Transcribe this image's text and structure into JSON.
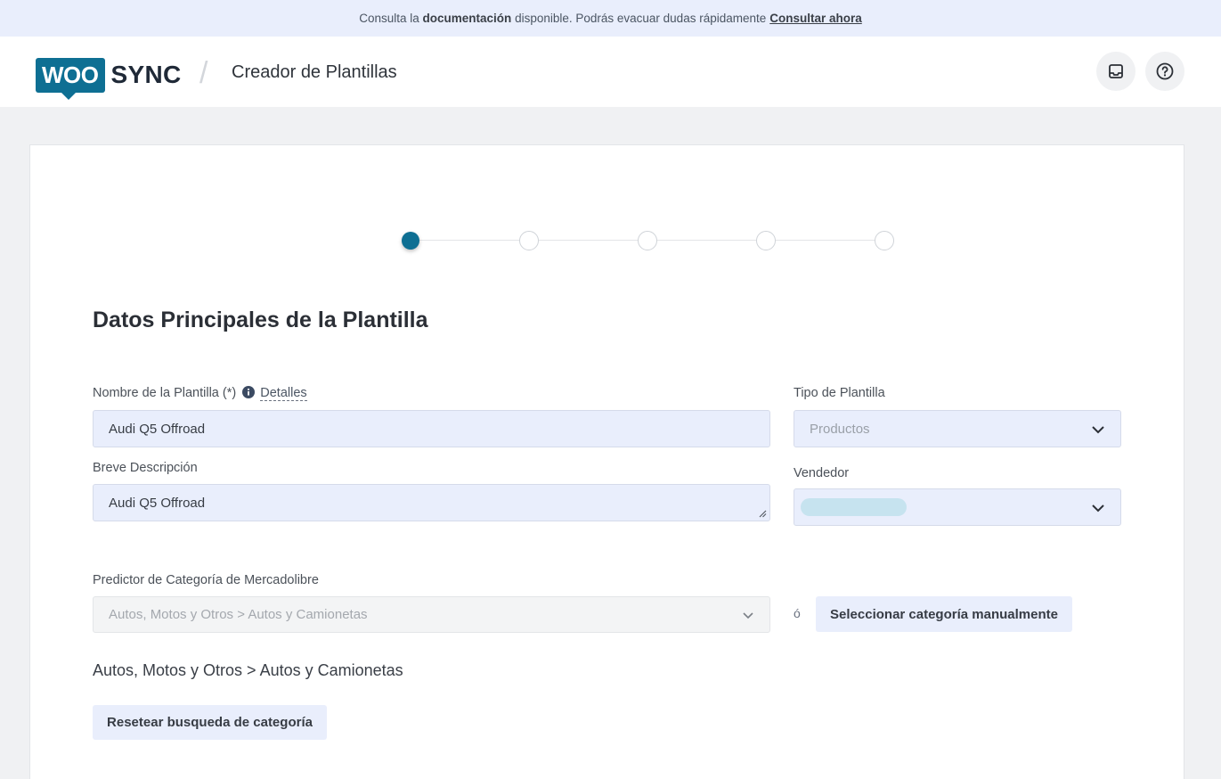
{
  "notice": {
    "prefix": "Consulta la",
    "bold": "documentación",
    "suffix": "disponible. Podrás evacuar dudas rápidamente",
    "link": "Consultar ahora"
  },
  "header": {
    "logo_left": "WOO",
    "logo_right": "SYNC",
    "separator": "/",
    "title": "Creador de Plantillas",
    "buttons": [
      {
        "name": "inbox",
        "icon": "inbox-icon"
      },
      {
        "name": "help",
        "icon": "help-circle-icon"
      }
    ]
  },
  "stepper": {
    "total_steps": 5,
    "active_step": 1
  },
  "form": {
    "section_title": "Datos Principales de la Plantilla",
    "template_name": {
      "label": "Nombre de la Plantilla (*)",
      "details_link": "Detalles",
      "value": "Audi Q5 Offroad"
    },
    "short_description": {
      "label": "Breve Descripción",
      "value": "Audi Q5 Offroad"
    },
    "template_type": {
      "label": "Tipo de Plantilla",
      "value": "Productos"
    },
    "seller": {
      "label": "Vendedor",
      "value": ""
    },
    "category_predictor": {
      "label": "Predictor de Categoría de Mercadolibre",
      "value": "Autos, Motos y Otros > Autos y Camionetas"
    },
    "or_text": "ó",
    "manual_category_button": "Seleccionar categoría manualmente",
    "selected_category": "Autos, Motos y Otros > Autos y Camionetas",
    "reset_button": "Resetear busqueda de categoría"
  },
  "colors": {
    "accent": "#0e6f93",
    "input_bg": "#e9eefc",
    "banner_bg": "#e9eefc",
    "page_bg": "#f0f1f3"
  }
}
